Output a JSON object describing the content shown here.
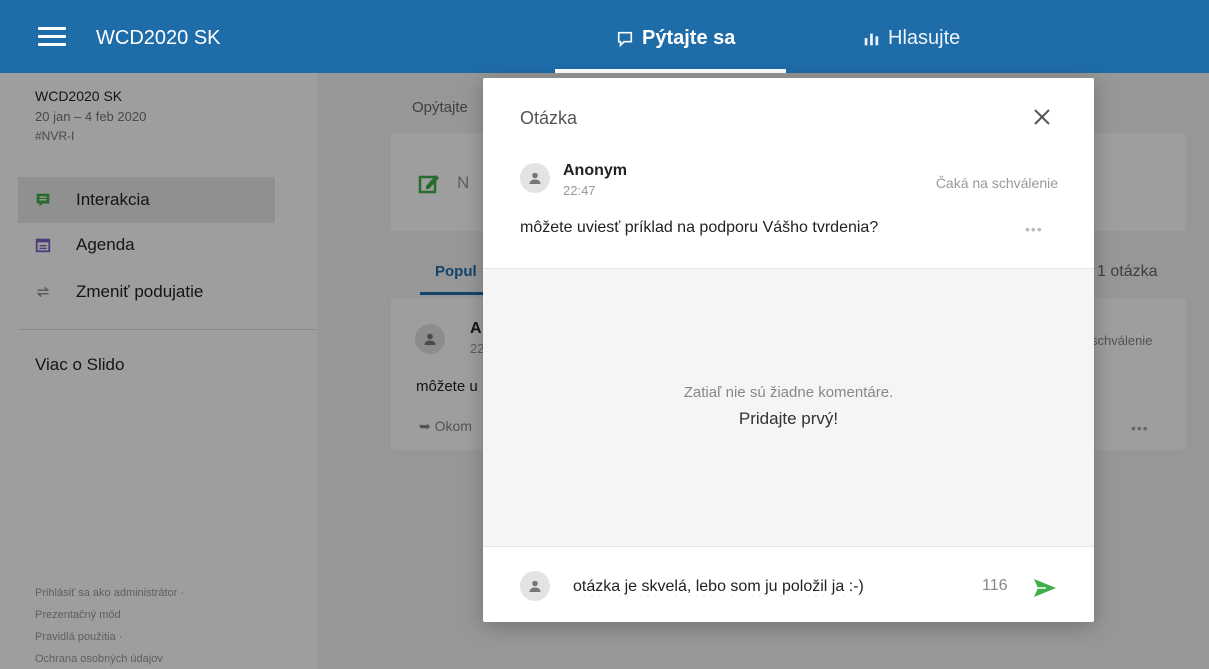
{
  "header": {
    "brand": "WCD2020 SK",
    "tab_ask": "Pýtajte sa",
    "tab_vote": "Hlasujte"
  },
  "sidebar": {
    "event_name": "WCD2020 SK",
    "event_date": "20 jan – 4 feb 2020",
    "event_code": "#NVR-I",
    "items": [
      {
        "label": "Interakcia",
        "icon": "chat-icon",
        "active": true
      },
      {
        "label": "Agenda",
        "icon": "calendar-icon",
        "active": false
      },
      {
        "label": "Zmeniť podujatie",
        "icon": "swap-icon",
        "active": false
      }
    ],
    "more": "Viac o Slido",
    "footer": [
      "Prihlásiť sa ako administrátor ·",
      "Prezentačný mód",
      "Pravidlá použitia ·",
      "Ochrana osobných údajov"
    ]
  },
  "main": {
    "ask_label": "Opýtajte",
    "new_question_text": "N",
    "tab_popular": "Popul",
    "question_count": "1 otázka",
    "card": {
      "author": "A",
      "time": "22",
      "question": "môžete u",
      "comment": "Okom",
      "status": "schválenie"
    }
  },
  "modal": {
    "title": "Otázka",
    "author": "Anonym",
    "time": "22:47",
    "status": "Čaká na schválenie",
    "question": "môžete uviesť príklad na podporu Vášho tvrdenia?",
    "empty_line1": "Zatiaľ nie sú žiadne komentáre.",
    "empty_line2": "Pridajte prvý!",
    "comment_value": "otázka je skvelá, lebo som ju položil ja :-)",
    "char_counter": "116"
  },
  "colors": {
    "header_bg": "#1e6ca8",
    "accent_green": "#3fae49",
    "agenda_purple": "#7b61c9"
  }
}
